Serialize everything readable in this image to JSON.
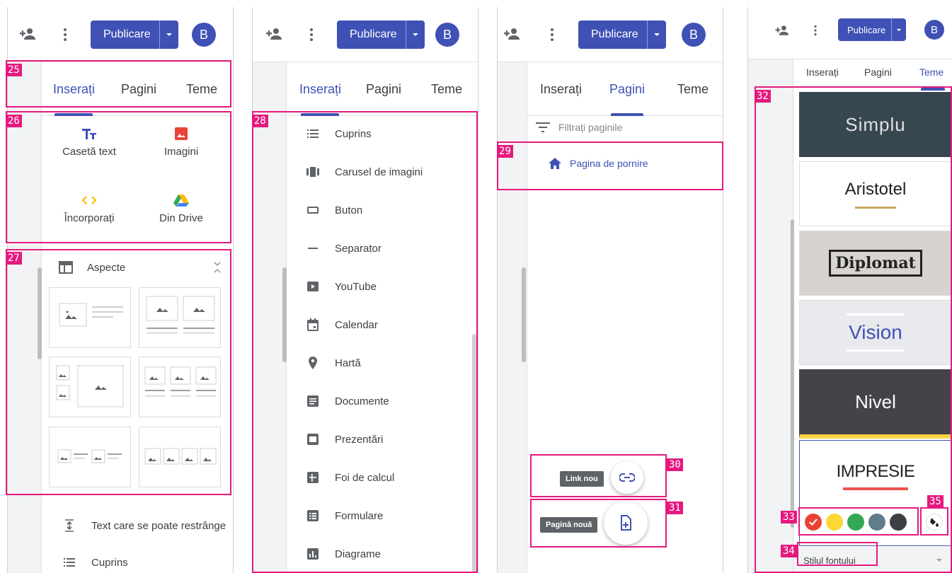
{
  "topbar": {
    "publish_label": "Publicare",
    "avatar_letter": "B"
  },
  "tabs": {
    "insert": "Inserați",
    "pages": "Pagini",
    "themes": "Teme"
  },
  "annotations": {
    "a25": "25",
    "a26": "26",
    "a27": "27",
    "a28": "28",
    "a29": "29",
    "a30": "30",
    "a31": "31",
    "a32": "32",
    "a33": "33",
    "a34": "34",
    "a35": "35"
  },
  "panel1": {
    "insert_items": [
      "Casetă text",
      "Imagini",
      "Încorporați",
      "Din Drive"
    ],
    "layouts_label": "Aspecte",
    "bottom_items": [
      "Text care se poate restrânge",
      "Cuprins"
    ]
  },
  "panel2": {
    "items": [
      "Cuprins",
      "Carusel de imagini",
      "Buton",
      "Separator",
      "YouTube",
      "Calendar",
      "Hartă",
      "Documente",
      "Prezentări",
      "Foi de calcul",
      "Formulare",
      "Diagrame"
    ]
  },
  "panel3": {
    "filter_placeholder": "Filtrați paginile",
    "home_page": "Pagina de pornire",
    "new_link_tooltip": "Link nou",
    "new_page_tooltip": "Pagină nouă"
  },
  "panel4": {
    "themes": [
      "Simplu",
      "Aristotel",
      "Diplomat",
      "Vision",
      "Nivel",
      "IMPRESIE"
    ],
    "font_style": "Stilul fontului",
    "colors": {
      "brand": "#3f51b5",
      "accent": "#e6197e",
      "swatch_red": "#ea4335",
      "swatch_yellow": "#fdd835",
      "swatch_green": "#34a853",
      "swatch_slate": "#607d8b",
      "swatch_dark": "#3c4043"
    }
  }
}
